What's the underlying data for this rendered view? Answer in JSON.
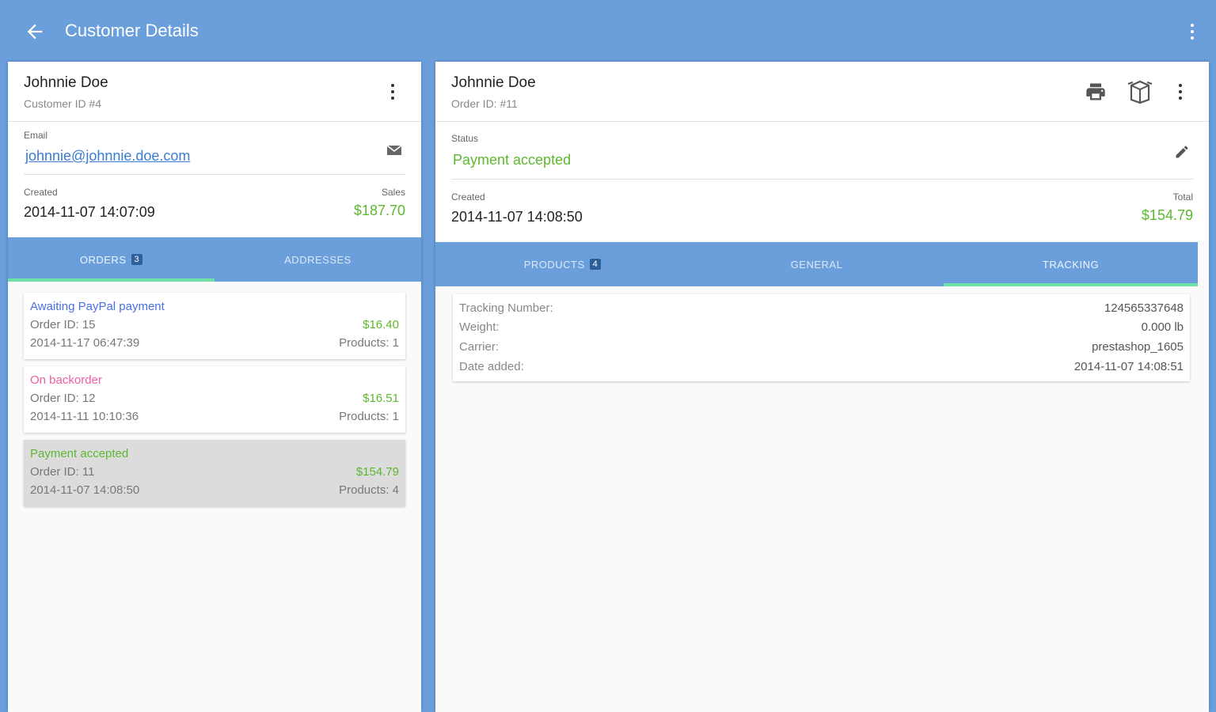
{
  "appbar": {
    "title": "Customer Details",
    "bg_color": "#6a9fdc"
  },
  "customer": {
    "name": "Johnnie Doe",
    "id_label": "Customer ID #4",
    "email_label": "Email",
    "email": "johnnie@johnnie.doe.com",
    "created_label": "Created",
    "created": "2014-11-07 14:07:09",
    "sales_label": "Sales",
    "sales": "$187.70",
    "tabs": [
      {
        "label": "ORDERS",
        "badge": "3"
      },
      {
        "label": "ADDRESSES"
      }
    ],
    "orders": [
      {
        "status": "Awaiting PayPal payment",
        "status_color": "#4a6fe0",
        "order_id": "Order ID: 15",
        "amount": "$16.40",
        "date": "2014-11-17 06:47:39",
        "products": "Products: 1"
      },
      {
        "status": "On backorder",
        "status_color": "#ef5fa0",
        "order_id": "Order ID: 12",
        "amount": "$16.51",
        "date": "2014-11-11 10:10:36",
        "products": "Products: 1"
      },
      {
        "status": "Payment accepted",
        "status_color": "#5cb82f",
        "order_id": "Order ID: 11",
        "amount": "$154.79",
        "date": "2014-11-07 14:08:50",
        "products": "Products: 4"
      }
    ]
  },
  "order": {
    "name": "Johnnie Doe",
    "id_label": "Order ID: #11",
    "status_label": "Status",
    "status": "Payment accepted",
    "created_label": "Created",
    "created": "2014-11-07 14:08:50",
    "total_label": "Total",
    "total": "$154.79",
    "tabs": [
      {
        "label": "PRODUCTS",
        "badge": "4"
      },
      {
        "label": "GENERAL"
      },
      {
        "label": "TRACKING"
      }
    ],
    "tracking": [
      {
        "key": "Tracking Number:",
        "value": "124565337648"
      },
      {
        "key": "Weight:",
        "value": "0.000 lb"
      },
      {
        "key": "Carrier:",
        "value": "prestashop_1605"
      },
      {
        "key": "Date added:",
        "value": "2014-11-07 14:08:51"
      }
    ]
  }
}
